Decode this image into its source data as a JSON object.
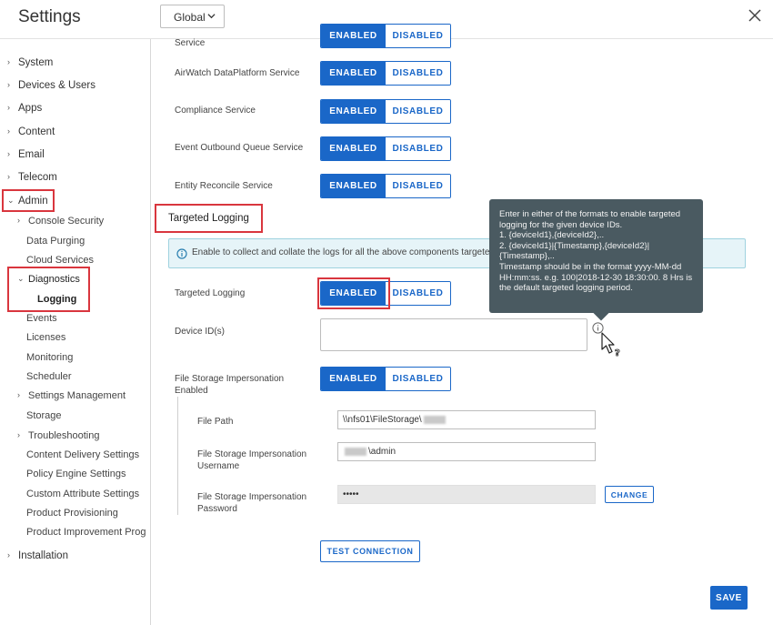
{
  "header": {
    "title": "Settings",
    "scope": "Global",
    "close_icon": "close-icon"
  },
  "sidebar": {
    "items": [
      {
        "label": "System",
        "expanded": false
      },
      {
        "label": "Devices & Users",
        "expanded": false
      },
      {
        "label": "Apps",
        "expanded": false
      },
      {
        "label": "Content",
        "expanded": false
      },
      {
        "label": "Email",
        "expanded": false
      },
      {
        "label": "Telecom",
        "expanded": false
      },
      {
        "label": "Admin",
        "expanded": true
      },
      {
        "label": "Installation",
        "expanded": false
      }
    ],
    "admin_children": [
      "Console Security",
      "Data Purging",
      "Cloud Services",
      "Diagnostics",
      "Logging",
      "Events",
      "Licenses",
      "Monitoring",
      "Scheduler",
      "Settings Management",
      "Storage",
      "Troubleshooting",
      "Content Delivery Settings",
      "Policy Engine Settings",
      "Custom Attribute Settings",
      "Product Provisioning",
      "Product Improvement Prog"
    ]
  },
  "toggle_labels": {
    "enabled": "ENABLED",
    "disabled": "DISABLED"
  },
  "services": [
    {
      "label": "Service",
      "state": "ENABLED"
    },
    {
      "label": "AirWatch DataPlatform Service",
      "state": "ENABLED"
    },
    {
      "label": "Compliance Service",
      "state": "ENABLED"
    },
    {
      "label": "Event Outbound Queue Service",
      "state": "ENABLED"
    },
    {
      "label": "Entity Reconcile Service",
      "state": "ENABLED"
    }
  ],
  "targeted": {
    "section_title": "Targeted Logging",
    "info_text": "Enable to collect and collate the logs for all the above components targeted t",
    "toggle_label": "Targeted Logging",
    "toggle_state": "ENABLED",
    "device_ids_label": "Device ID(s)",
    "device_ids_value": ""
  },
  "tooltip": {
    "lines": [
      "Enter in either of the formats to enable targeted",
      "logging for the given device IDs.",
      "1. {deviceId1},{deviceId2},..",
      "2. {deviceId1}|{Timestamp},{deviceId2}|",
      "{Timestamp},..",
      "Timestamp should be in the format yyyy-MM-dd",
      "HH:mm:ss. e.g. 100|2018-12-30 18:30:00. 8 Hrs is",
      "the default targeted logging period."
    ]
  },
  "storage": {
    "impersonation_label_1": "File Storage Impersonation",
    "impersonation_label_2": "Enabled",
    "impersonation_state": "ENABLED",
    "file_path_label": "File Path",
    "file_path_value": "\\\\nfs01\\FileStorage\\",
    "username_label_1": "File Storage Impersonation",
    "username_label_2": "Username",
    "username_value": "\\admin",
    "password_label_1": "File Storage Impersonation",
    "password_label_2": "Password",
    "password_value": "•••••",
    "change_label": "CHANGE",
    "test_label": "TEST CONNECTION"
  },
  "footer": {
    "save_label": "SAVE"
  },
  "colors": {
    "primary": "#1a67c8",
    "highlight": "#d9363e",
    "tooltip": "#4a5a61",
    "info_bg": "#e6f4f8"
  }
}
